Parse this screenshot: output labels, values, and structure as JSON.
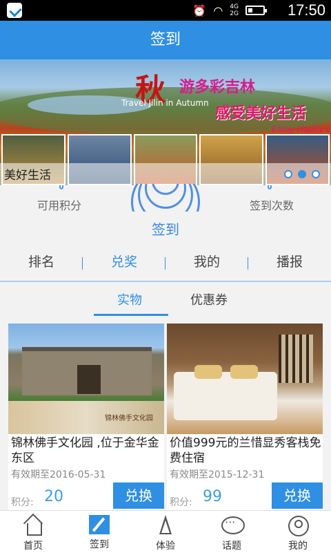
{
  "status_bar": {
    "network1": "4G",
    "network2": "2G",
    "time": "17:50"
  },
  "header": {
    "title": "签到"
  },
  "banner": {
    "title_char": "秋",
    "title_rest": "游多彩吉林",
    "subtitle": "Travel Jilin in Autumn",
    "slogan": "感受美好生活",
    "slogan_en": "Enjoy Happy L",
    "caption": "美好生活",
    "slides": 3,
    "active_slide": 2
  },
  "checkin": {
    "left_label": "可用积分",
    "right_label": "签到次数",
    "button_label": "签到"
  },
  "tabs": [
    {
      "label": "排名"
    },
    {
      "label": "兑奖"
    },
    {
      "label": "我的"
    },
    {
      "label": "播报"
    }
  ],
  "subtabs": [
    {
      "label": "实物"
    },
    {
      "label": "优惠券"
    }
  ],
  "products": [
    {
      "name": "锦林佛手文化园 ,位于金华金东区",
      "valid": "有效期至2016-05-31",
      "points_label": "积分:",
      "points": "20",
      "redeem_label": "兑换",
      "image_text": "锦林佛手文化园"
    },
    {
      "name": "价值999元的兰惜显秀客栈免费住宿",
      "valid": "有效期至2015-12-31",
      "points_label": "积分:",
      "points": "99",
      "redeem_label": "兑换"
    }
  ],
  "bottom_nav": [
    {
      "label": "首页",
      "icon": "home-icon"
    },
    {
      "label": "签到",
      "icon": "checkin-icon"
    },
    {
      "label": "体验",
      "icon": "paper-plane-icon"
    },
    {
      "label": "话题",
      "icon": "chat-bubble-icon"
    },
    {
      "label": "我的",
      "icon": "user-icon"
    }
  ],
  "colors": {
    "accent": "#2f8fe3",
    "points": "#3a9ee8"
  }
}
